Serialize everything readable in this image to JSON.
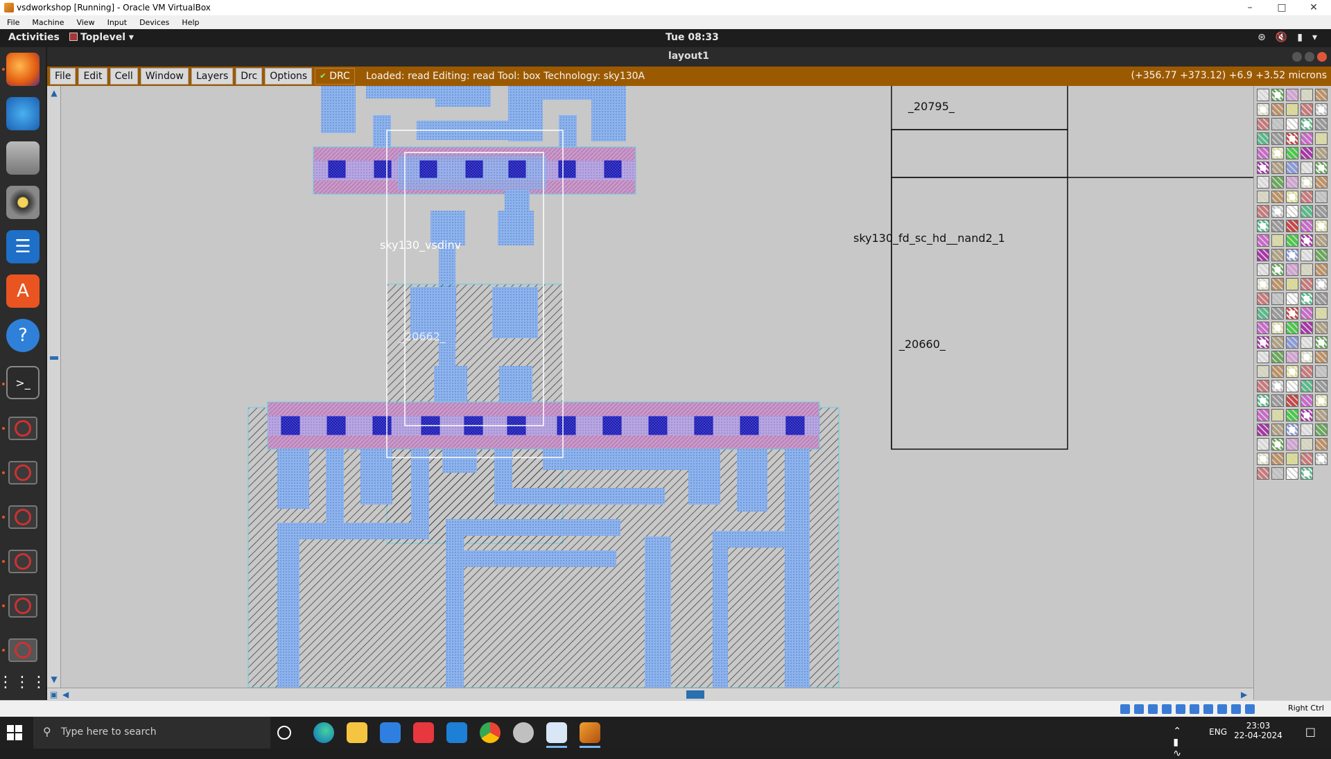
{
  "vbox": {
    "title": "vsdworkshop [Running] - Oracle VM VirtualBox",
    "menu": [
      "File",
      "Machine",
      "View",
      "Input",
      "Devices",
      "Help"
    ],
    "host_key": "Right Ctrl"
  },
  "topbar": {
    "activities": "Activities",
    "app_menu": "Toplevel",
    "clock": "Tue 08:33"
  },
  "window": {
    "title": "layout1"
  },
  "magic": {
    "menu": [
      "File",
      "Edit",
      "Cell",
      "Window",
      "Layers",
      "Drc",
      "Options"
    ],
    "drc_label": "DRC",
    "status": "Loaded: read  Editing: read  Tool: box  Technology: sky130A",
    "coords": "(+356.77 +373.12) +6.9 +3.52 microns"
  },
  "layout": {
    "cells": {
      "inverter_name": "sky130_vsdinv",
      "inverter_id": "_20662_",
      "top_right_id": "_20795_",
      "nand_name": "sky130_fd_sc_hd__nand2_1",
      "nand_id": "_20660_"
    }
  },
  "taskbar": {
    "search_placeholder": "Type here to search",
    "language": "ENG",
    "time": "23:03",
    "date": "22-04-2024"
  },
  "colors": {
    "magic_bar": "#9c5a00",
    "canvas_bg": "#c8c8c8",
    "metal1": "#8fb4ec",
    "local_interconnect": "#a6a6f0",
    "via": "#3333dd",
    "pwell_hatch": "#333333"
  }
}
